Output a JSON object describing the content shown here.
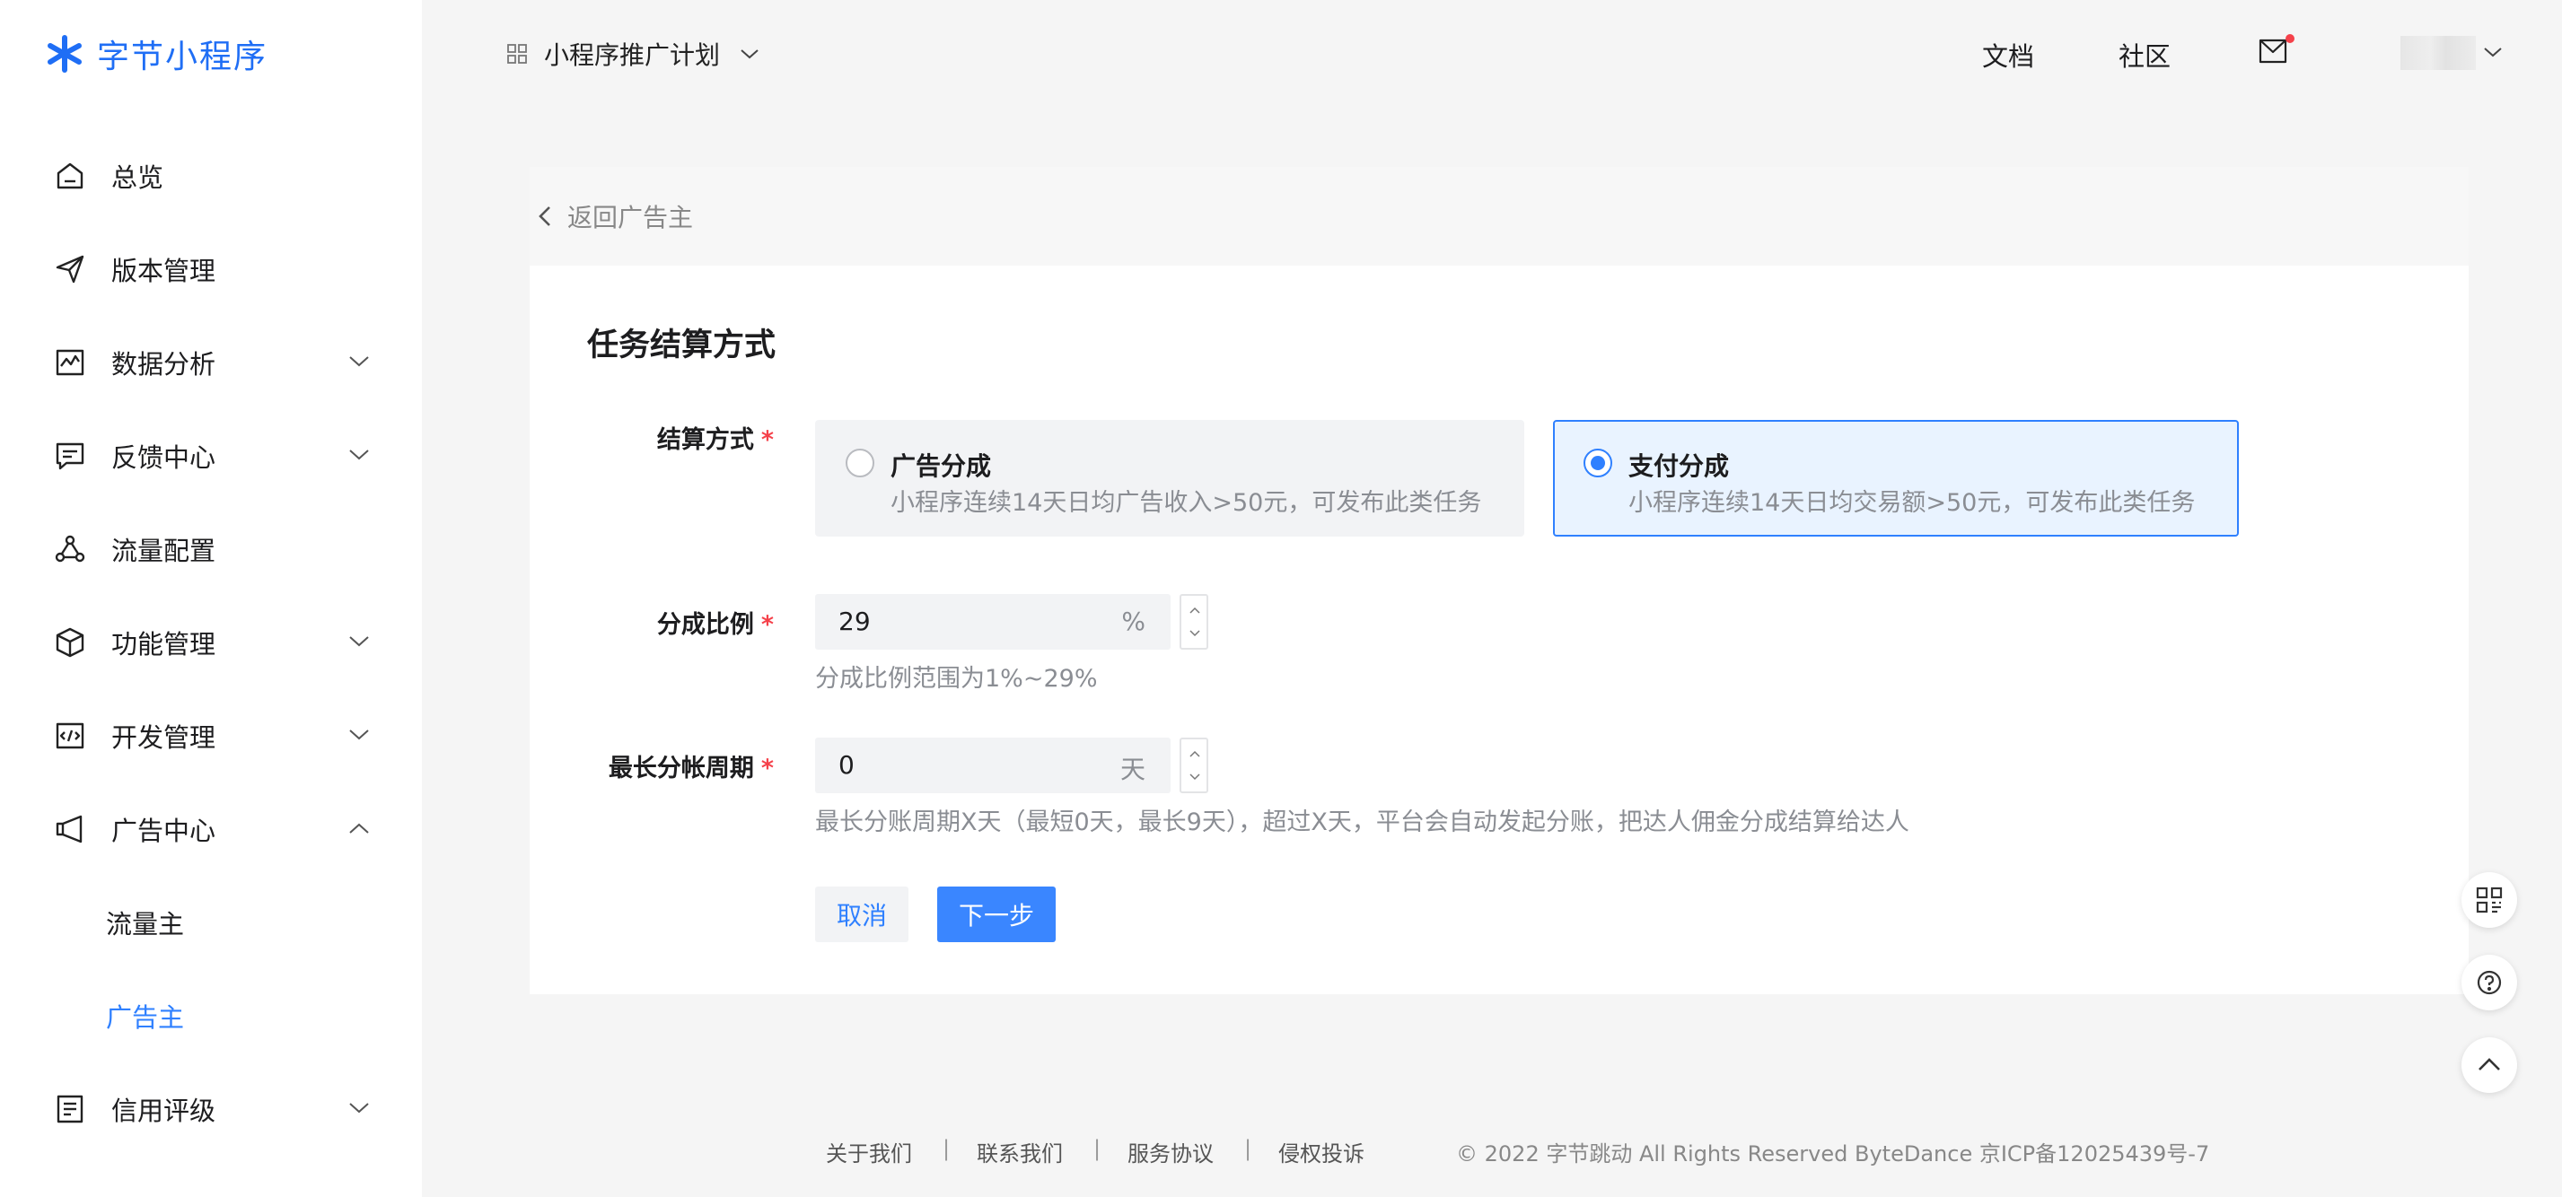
{
  "brand": {
    "name": "字节小程序",
    "color": "#1f6ef5"
  },
  "sidebar": {
    "items": [
      {
        "label": "总览",
        "icon": "home-icon",
        "expandable": false
      },
      {
        "label": "版本管理",
        "icon": "send-icon",
        "expandable": false
      },
      {
        "label": "数据分析",
        "icon": "chart-icon",
        "expandable": true,
        "expanded": false
      },
      {
        "label": "反馈中心",
        "icon": "message-icon",
        "expandable": true,
        "expanded": false
      },
      {
        "label": "流量配置",
        "icon": "share-icon",
        "expandable": false
      },
      {
        "label": "功能管理",
        "icon": "box-icon",
        "expandable": true,
        "expanded": false
      },
      {
        "label": "开发管理",
        "icon": "code-icon",
        "expandable": true,
        "expanded": false
      },
      {
        "label": "广告中心",
        "icon": "megaphone-icon",
        "expandable": true,
        "expanded": true,
        "children": [
          {
            "label": "流量主",
            "active": false
          },
          {
            "label": "广告主",
            "active": true
          }
        ]
      },
      {
        "label": "信用评级",
        "icon": "list-icon",
        "expandable": true,
        "expanded": false
      }
    ]
  },
  "topbar": {
    "project": "小程序推广计划",
    "links": [
      "文档",
      "社区"
    ],
    "has_notification": true
  },
  "back": {
    "label": "返回广告主"
  },
  "form": {
    "title": "任务结算方式",
    "settlement": {
      "label": "结算方式",
      "options": [
        {
          "title": "广告分成",
          "desc": "小程序连续14天日均广告收入>50元，可发布此类任务",
          "selected": false
        },
        {
          "title": "支付分成",
          "desc": "小程序连续14天日均交易额>50元，可发布此类任务",
          "selected": true
        }
      ]
    },
    "ratio": {
      "label": "分成比例",
      "value": "29",
      "unit": "%",
      "hint": "分成比例范围为1%~29%"
    },
    "period": {
      "label": "最长分帐周期",
      "value": "0",
      "unit": "天",
      "hint": "最长分账周期X天（最短0天，最长9天），超过X天，平台会自动发起分账，把达人佣金分成结算给达人"
    },
    "required_mark": "*",
    "buttons": {
      "cancel": "取消",
      "next": "下一步"
    }
  },
  "footer": {
    "links": [
      "关于我们",
      "联系我们",
      "服务协议",
      "侵权投诉"
    ],
    "separator": "|",
    "copyright": "© 2022 字节跳动 All Rights Reserved ByteDance 京ICP备12025439号-7"
  },
  "colors": {
    "accent": "#2f80ff",
    "required": "#f5414a"
  }
}
